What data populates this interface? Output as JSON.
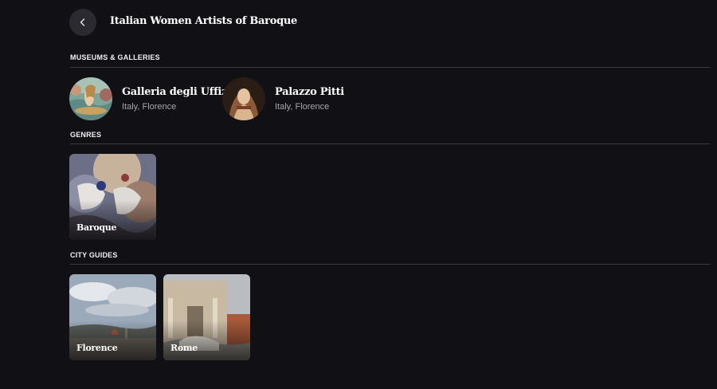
{
  "header": {
    "title": "Italian Women Artists of Baroque",
    "back_icon": "chevron-left-icon"
  },
  "museums": {
    "heading": "MUSEUMS & GALLERIES",
    "items": [
      {
        "name": "Galleria degli Uffizi",
        "location": "Italy, Florence"
      },
      {
        "name": "Palazzo Pitti",
        "location": "Italy, Florence"
      }
    ]
  },
  "genres": {
    "heading": "GENRES",
    "items": [
      {
        "label": "Baroque"
      }
    ]
  },
  "city_guides": {
    "heading": "CITY GUIDES",
    "items": [
      {
        "label": "Florence"
      },
      {
        "label": "Rome"
      }
    ]
  },
  "colors": {
    "background": "#111015",
    "back_button": "#2b2a30",
    "divider": "#3a3940",
    "secondary_text": "#a8a7ad"
  }
}
